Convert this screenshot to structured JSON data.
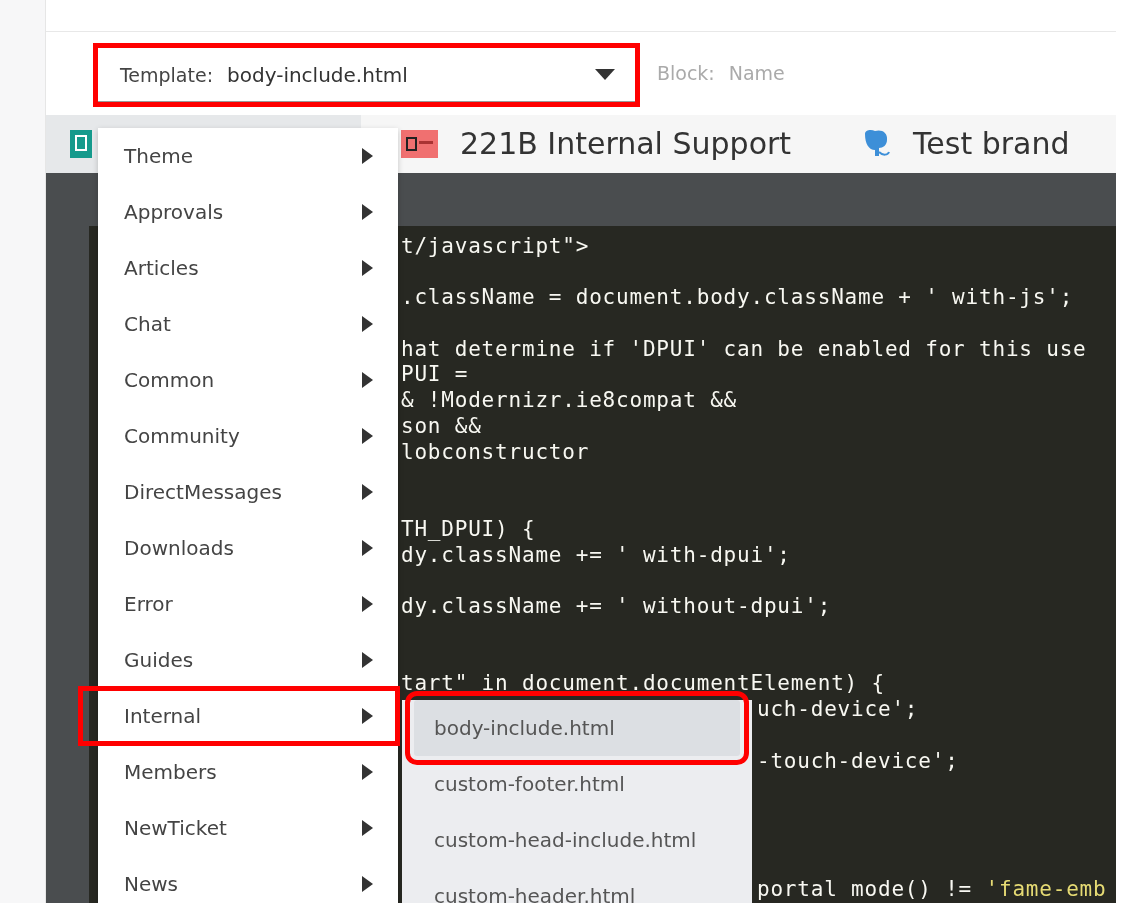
{
  "template_select": {
    "label": "Template:",
    "value": "body-include.html",
    "highlighted": true
  },
  "block_select": {
    "label": "Block:",
    "placeholder": "Name"
  },
  "brands": [
    {
      "name": "221B Internal Support"
    },
    {
      "name": "Test brand"
    }
  ],
  "code_lines": [
    {
      "kind": "code",
      "parts": [
        {
          "text": "t/javascript\">",
          "kind": "plain"
        }
      ]
    },
    {
      "kind": "blank"
    },
    {
      "kind": "code",
      "parts": [
        {
          "text": ".className = document.body.className + ' with-js';",
          "kind": "plain"
        }
      ]
    },
    {
      "kind": "blank"
    },
    {
      "kind": "code",
      "parts": [
        {
          "text": "hat determine if 'DPUI' can be enabled for this use",
          "kind": "plain"
        }
      ]
    },
    {
      "kind": "code",
      "parts": [
        {
          "text": "PUI =",
          "kind": "plain"
        }
      ]
    },
    {
      "kind": "code",
      "parts": [
        {
          "text": "& !Modernizr.ie8compat &&",
          "kind": "plain"
        }
      ]
    },
    {
      "kind": "code",
      "parts": [
        {
          "text": "son &&",
          "kind": "plain"
        }
      ]
    },
    {
      "kind": "code",
      "parts": [
        {
          "text": "lobconstructor",
          "kind": "plain"
        }
      ]
    },
    {
      "kind": "blank"
    },
    {
      "kind": "blank"
    },
    {
      "kind": "code",
      "parts": [
        {
          "text": "TH_DPUI) {",
          "kind": "plain"
        }
      ]
    },
    {
      "kind": "code",
      "parts": [
        {
          "text": "dy.className += ' with-dpui';",
          "kind": "plain"
        }
      ]
    },
    {
      "kind": "blank"
    },
    {
      "kind": "code",
      "parts": [
        {
          "text": "dy.className += ' without-dpui';",
          "kind": "plain"
        }
      ]
    },
    {
      "kind": "blank"
    },
    {
      "kind": "blank"
    },
    {
      "kind": "code",
      "parts": [
        {
          "text": "tart\" in document.documentElement) {",
          "kind": "plain"
        }
      ]
    },
    {
      "kind": "code_right",
      "parts": [
        {
          "text": "uch-device';",
          "kind": "plain"
        }
      ]
    },
    {
      "kind": "blank"
    },
    {
      "kind": "code_right",
      "parts": [
        {
          "text": "-touch-device';",
          "kind": "plain"
        }
      ]
    },
    {
      "kind": "blank"
    },
    {
      "kind": "blank"
    },
    {
      "kind": "blank"
    },
    {
      "kind": "blank"
    },
    {
      "kind": "code_right",
      "parts": [
        {
          "text": "portal mode() != ",
          "kind": "plain"
        },
        {
          "text": "'fame-emb",
          "kind": "string"
        }
      ]
    }
  ],
  "menu": {
    "items": [
      {
        "label": "Theme",
        "highlighted": false
      },
      {
        "label": "Approvals",
        "highlighted": false
      },
      {
        "label": "Articles",
        "highlighted": false
      },
      {
        "label": "Chat",
        "highlighted": false
      },
      {
        "label": "Common",
        "highlighted": false
      },
      {
        "label": "Community",
        "highlighted": false
      },
      {
        "label": "DirectMessages",
        "highlighted": false
      },
      {
        "label": "Downloads",
        "highlighted": false
      },
      {
        "label": "Error",
        "highlighted": false
      },
      {
        "label": "Guides",
        "highlighted": false
      },
      {
        "label": "Internal",
        "highlighted": true
      },
      {
        "label": "Members",
        "highlighted": false
      },
      {
        "label": "NewTicket",
        "highlighted": false
      },
      {
        "label": "News",
        "highlighted": false
      }
    ]
  },
  "submenu": {
    "items": [
      {
        "label": "body-include.html",
        "selected": true,
        "highlighted": true
      },
      {
        "label": "custom-footer.html",
        "selected": false,
        "highlighted": false
      },
      {
        "label": "custom-head-include.html",
        "selected": false,
        "highlighted": false
      },
      {
        "label": "custom-header.html",
        "selected": false,
        "highlighted": false
      }
    ]
  }
}
